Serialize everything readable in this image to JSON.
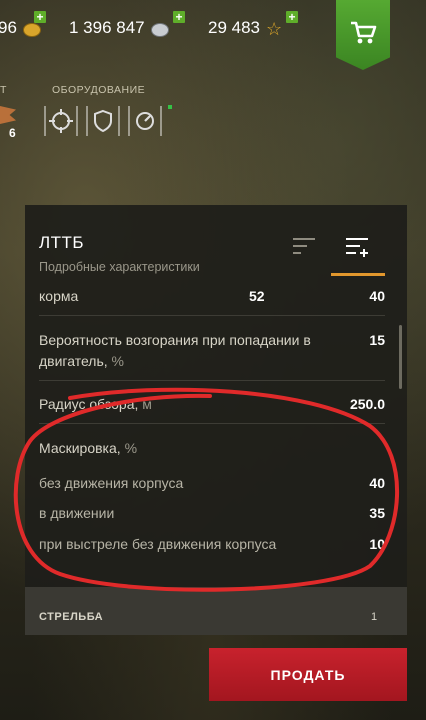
{
  "currency": {
    "gold_partial": "96",
    "credits": "1 396 847",
    "free_xp": "29 483"
  },
  "header": {
    "left_label_partial": "Т",
    "equipment_label": "ОБОРУДОВАНИЕ",
    "consumable_count": "6"
  },
  "panel": {
    "title": "ЛТТБ",
    "subtitle": "Подробные характеристики",
    "rows": {
      "hull_label": "корма",
      "hull_v1": "52",
      "hull_v2": "40",
      "fire_label": "Вероятность возгорания при попадании в двигатель,",
      "fire_unit": "%",
      "fire_value": "15",
      "view_label": "Радиус обзора,",
      "view_unit": "м",
      "view_value": "250.0",
      "camo_label": "Маскировка,",
      "camo_unit": "%",
      "camo_still_label": "без движения корпуса",
      "camo_still_value": "40",
      "camo_moving_label": "в движении",
      "camo_moving_value": "35",
      "camo_fire_label": "при выстреле без движения корпуса",
      "camo_fire_value": "10"
    },
    "section_partial": "СТРЕЛЬБА",
    "section_partial_num": "1"
  },
  "actions": {
    "sell_label": "ПРОДАТЬ"
  },
  "colors": {
    "accent_orange": "#e2972d",
    "shop_green": "#4c9a2a",
    "sell_red": "#b81c26",
    "annotation_red": "#e02a2a"
  }
}
